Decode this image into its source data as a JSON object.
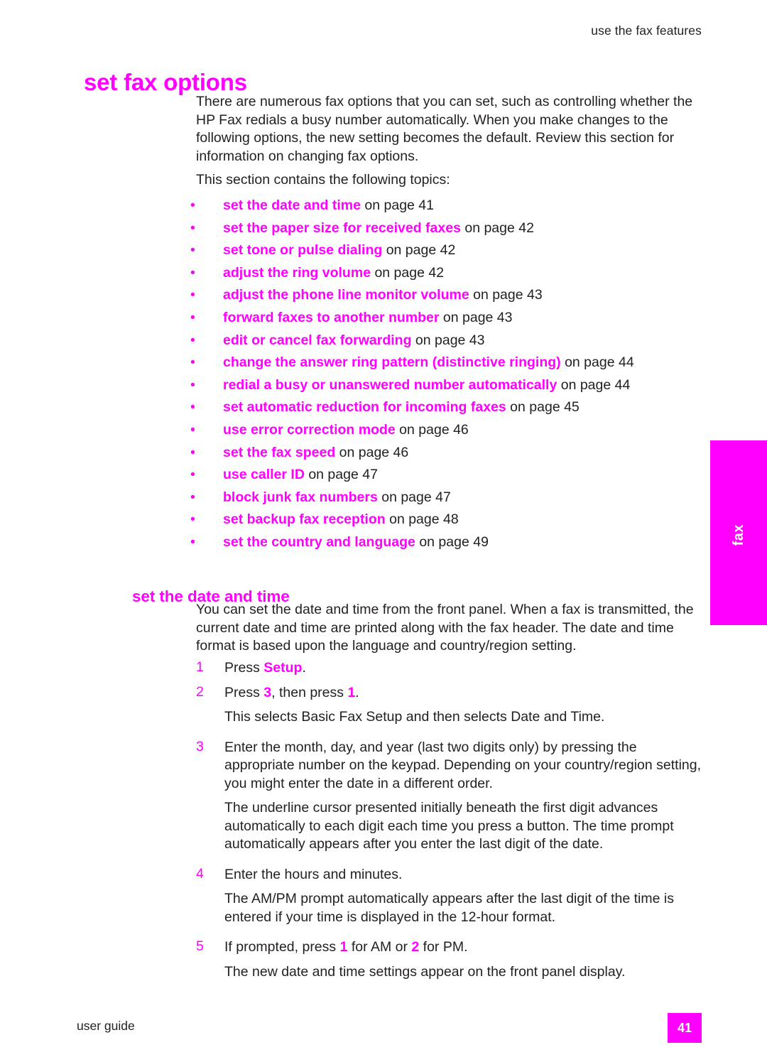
{
  "header": {
    "running_head": "use the fax features"
  },
  "side_tab": {
    "label": "fax",
    "color": "#ff00ff"
  },
  "title": "set fax options",
  "intro_paragraph": "There are numerous fax options that you can set, such as controlling whether the HP Fax redials a busy number automatically. When you make changes to the following options, the new setting becomes the default. Review this section for information on changing fax options.",
  "contains_line": "This section contains the following topics:",
  "toc": {
    "bullet": "•",
    "items": [
      {
        "link": "set the date and time",
        "suffix": "on page 41"
      },
      {
        "link": "set the paper size for received faxes",
        "suffix": "on page 42"
      },
      {
        "link": "set tone or pulse dialing",
        "suffix": "on page 42"
      },
      {
        "link": "adjust the ring volume",
        "suffix": "on page 42"
      },
      {
        "link": "adjust the phone line monitor volume",
        "suffix": "on page 43"
      },
      {
        "link": "forward faxes to another number",
        "suffix": "on page 43"
      },
      {
        "link": "edit or cancel fax forwarding",
        "suffix": "on page 43"
      },
      {
        "link": "change the answer ring pattern (distinctive ringing)",
        "suffix": "on page 44"
      },
      {
        "link": "redial a busy or unanswered number automatically",
        "suffix": "on page 44"
      },
      {
        "link": "set automatic reduction for incoming faxes",
        "suffix": "on page 45"
      },
      {
        "link": "use error correction mode",
        "suffix": "on page 46"
      },
      {
        "link": "set the fax speed",
        "suffix": "on page 46"
      },
      {
        "link": "use caller ID",
        "suffix": "on page 47"
      },
      {
        "link": "block junk fax numbers",
        "suffix": "on page 47"
      },
      {
        "link": "set backup fax reception",
        "suffix": "on page 48"
      },
      {
        "link": "set the country and language",
        "suffix": "on page 49"
      }
    ]
  },
  "section": {
    "heading": "set the date and time",
    "intro": "You can set the date and time from the front panel. When a fax is transmitted, the current date and time are printed along with the fax header. The date and time format is based upon the language and country/region setting.",
    "steps": [
      {
        "number": "1",
        "text_before": "Press ",
        "emphasis": "Setup",
        "text_after": "."
      },
      {
        "number": "2",
        "text_before": "Press ",
        "emphasis": "3",
        "text_mid": ", then press ",
        "emphasis2": "1",
        "text_after": ".",
        "follow_up": "This selects Basic Fax Setup and then selects Date and Time."
      },
      {
        "number": "3",
        "text": "Enter the month, day, and year (last two digits only) by pressing the appropriate number on the keypad. Depending on your country/region setting, you might enter the date in a different order.",
        "follow_up": "The underline cursor presented initially beneath the first digit advances automatically to each digit each time you press a button. The time prompt automatically appears after you enter the last digit of the date."
      },
      {
        "number": "4",
        "text": "Enter the hours and minutes.",
        "follow_up": "The AM/PM prompt automatically appears after the last digit of the time is entered if your time is displayed in the 12-hour format."
      },
      {
        "number": "5",
        "text_before": "If prompted, press ",
        "emphasis": "1",
        "text_mid": " for AM or ",
        "emphasis2": "2",
        "text_after": " for PM.",
        "follow_up": "The new date and time settings appear on the front panel display."
      }
    ]
  },
  "footer": {
    "left": "user guide",
    "page_number": "41"
  }
}
